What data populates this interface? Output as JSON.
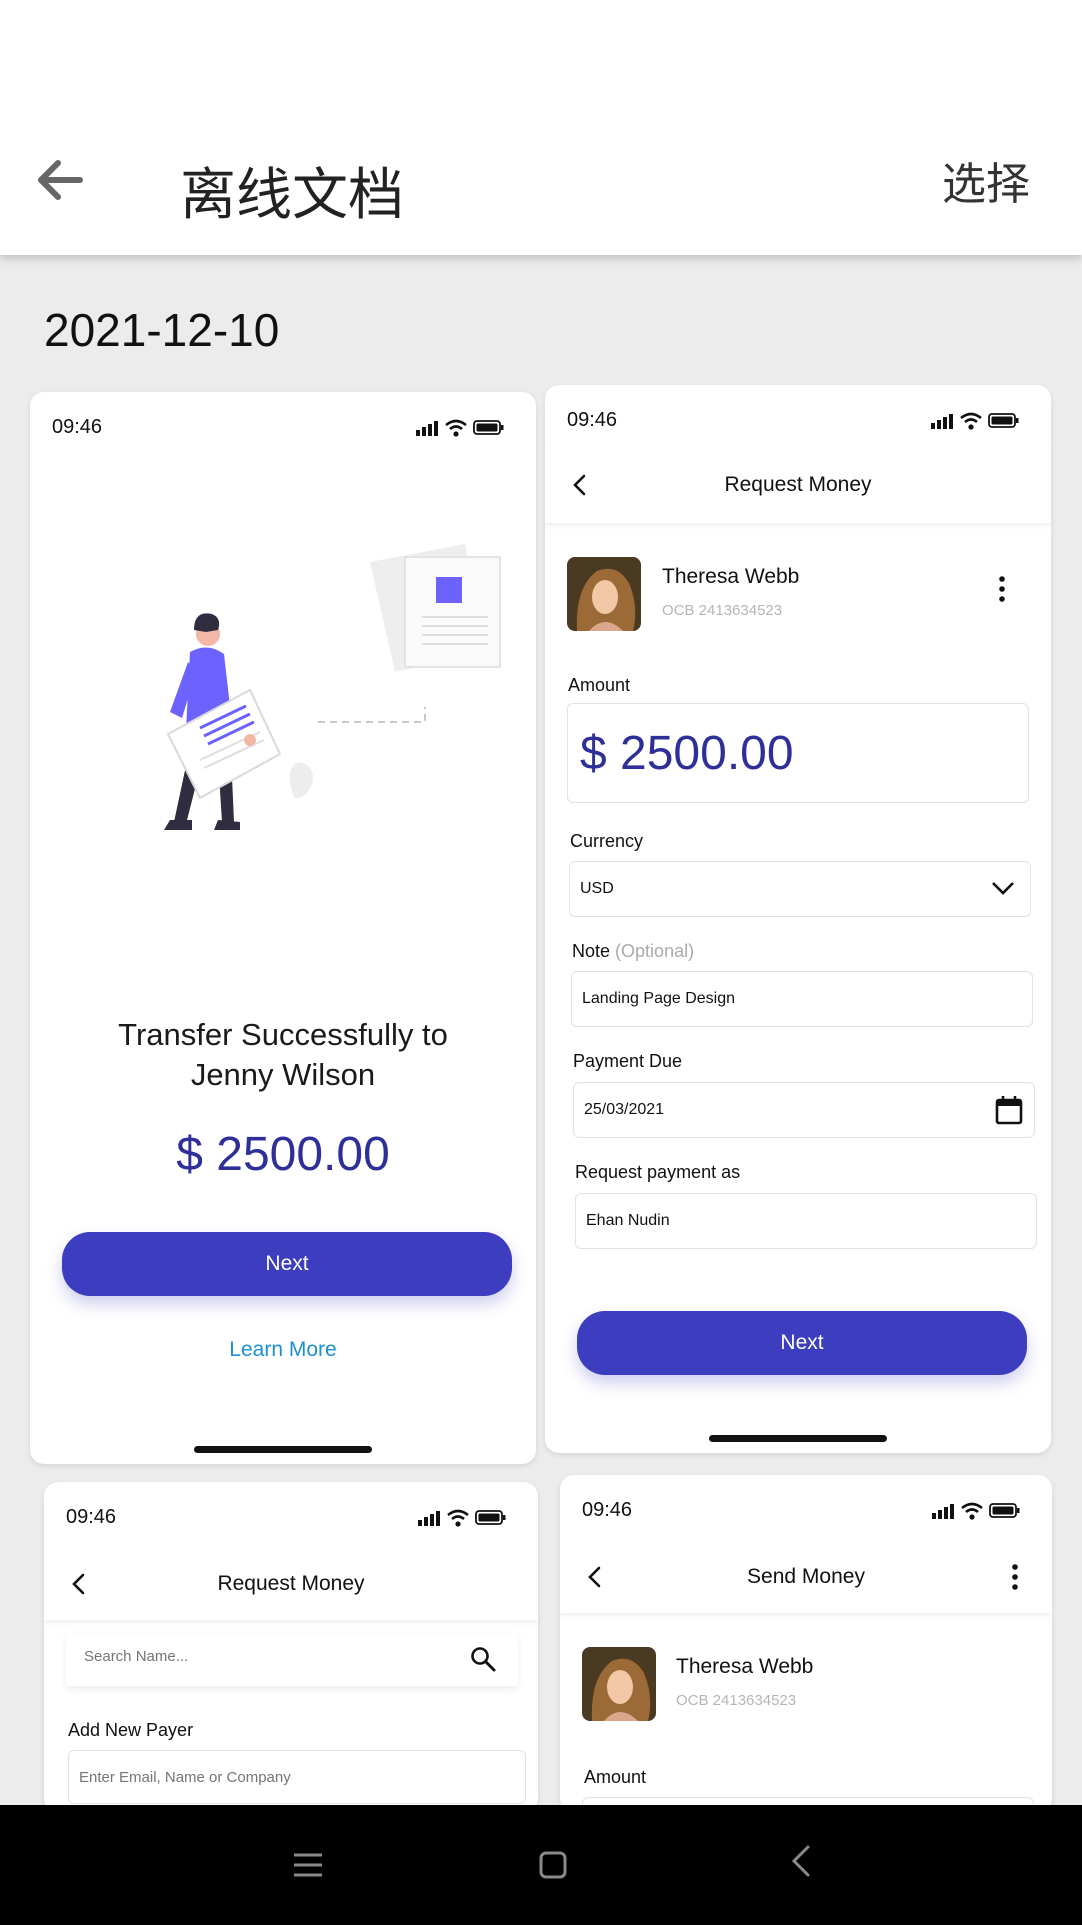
{
  "header": {
    "title": "离线文档",
    "select_label": "选择"
  },
  "date_label": "2021-12-10",
  "cards": {
    "success": {
      "time": "09:46",
      "message_line1": "Transfer Successfully to",
      "message_line2": "Jenny Wilson",
      "amount": "$ 2500.00",
      "next_label": "Next",
      "learn_more_label": "Learn More"
    },
    "request": {
      "time": "09:46",
      "title": "Request Money",
      "contact_name": "Theresa Webb",
      "contact_account": "OCB 2413634523",
      "amount_label": "Amount",
      "amount_value": "$ 2500.00",
      "currency_label": "Currency",
      "currency_value": "USD",
      "note_label": "Note",
      "note_optional": "(Optional)",
      "note_value": "Landing Page Design",
      "due_label": "Payment Due",
      "due_value": "25/03/2021",
      "request_as_label": "Request payment as",
      "request_as_value": "Ehan Nudin",
      "next_label": "Next"
    },
    "request_search": {
      "time": "09:46",
      "title": "Request Money",
      "search_placeholder": "Search Name...",
      "add_payer_label": "Add New Payer",
      "payer_placeholder": "Enter Email, Name or Company"
    },
    "send": {
      "time": "09:46",
      "title": "Send Money",
      "contact_name": "Theresa Webb",
      "contact_account": "OCB 2413634523",
      "amount_label": "Amount"
    }
  },
  "colors": {
    "accent": "#3c3dbf",
    "link": "#1e8fcf",
    "amount": "#2f2f9a"
  },
  "icons": [
    "back-arrow-icon",
    "signal-icon",
    "wifi-icon",
    "battery-icon",
    "chevron-left-icon",
    "kebab-menu-icon",
    "chevron-down-icon",
    "calendar-icon",
    "search-icon",
    "menu-icon",
    "home-square-icon",
    "back-triangle-icon"
  ]
}
